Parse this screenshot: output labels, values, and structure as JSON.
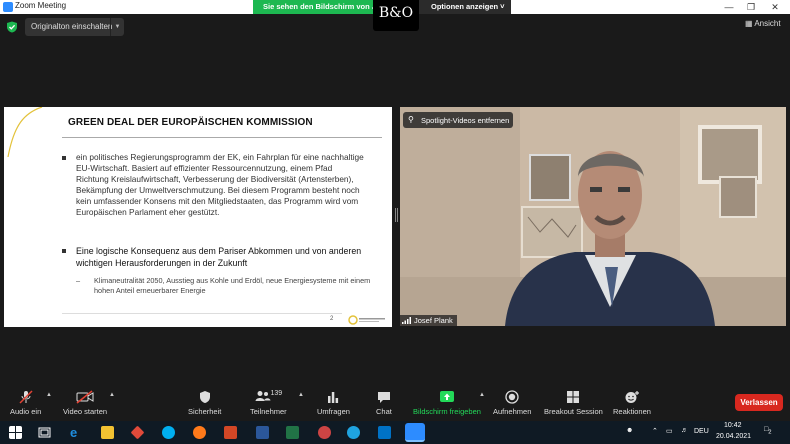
{
  "window": {
    "title": "Zoom Meeting"
  },
  "share_banner": {
    "status": "Sie sehen den Bildschirm von Jo",
    "options": "Optionen anzeigen"
  },
  "bo_logo": {
    "text": "B&O"
  },
  "header": {
    "original_sound": "Originalton einschalten",
    "view": "Ansicht"
  },
  "slide": {
    "title": "GREEN DEAL DER EUROPÄISCHEN KOMMISSION",
    "bullets": [
      "ein politisches Regierungsprogramm der EK, ein Fahrplan für eine nachhaltige EU-Wirtschaft. Basiert auf effizienter Ressourcennutzung, einem Pfad Richtung Kreislaufwirtschaft,  Verbesserung der Biodiversität (Artensterben), Bekämpfung der Umweltverschmutzung.  Bei diesem Programm besteht noch kein umfassender Konsens mit den Mitgliedstaaten, das Programm wird vom Europäischen Parlament eher gestützt.",
      "Eine logische Konsequenz aus dem Pariser Abkommen und von anderen wichtigen Herausforderungen in der Zukunft"
    ],
    "sub_bullet": "Klimaneutralität 2050, Ausstieg aus Kohle und Erdöl, neue Energiesysteme mit einem hohen Anteil erneuerbarer Energie",
    "page_number": "2"
  },
  "video": {
    "spotlight_label": "Spotlight-Videos entfernen",
    "participant_name": "Josef Plank"
  },
  "toolbar": {
    "audio": "Audio ein",
    "video": "Video starten",
    "security": "Sicherheit",
    "participants": "Teilnehmer",
    "participants_count": "139",
    "qa": "Umfragen",
    "chat": "Chat",
    "share": "Bildschirm freigeben",
    "record": "Aufnehmen",
    "breakout": "Breakout Session",
    "reactions": "Reaktionen",
    "leave": "Verlassen"
  },
  "taskbar": {
    "language": "DEU",
    "time": "10:42",
    "date": "20.04.2021",
    "notifications": "2"
  },
  "colors": {
    "zoom_green": "#1db851",
    "leave_red": "#d8281f",
    "share_green": "#23d959"
  }
}
